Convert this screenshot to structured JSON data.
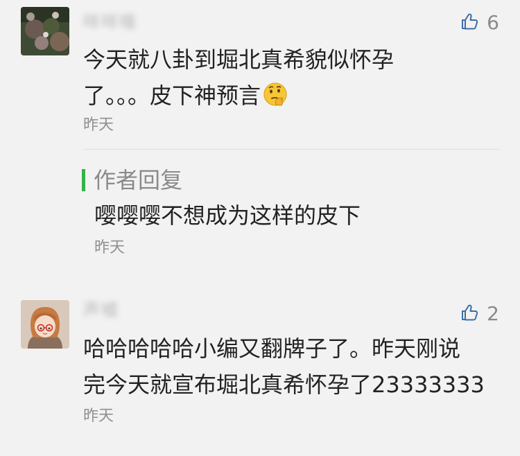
{
  "comments": [
    {
      "username": "咩咩嘻",
      "likes": "6",
      "content_line1": "今天就八卦到堀北真希貌似怀孕",
      "content_line2": "了。。。皮下神预言",
      "emoji": "thinking-face-icon",
      "time": "昨天",
      "reply": {
        "label": "作者回复",
        "content": "嘤嘤嘤不想成为这样的皮下",
        "time": "昨天"
      }
    },
    {
      "username": "声嘘",
      "likes": "2",
      "content_line1": "哈哈哈哈哈小编又翻牌子了。昨天刚说",
      "content_line2": "完今天就宣布堀北真希怀孕了23333333",
      "time": "昨天"
    }
  ],
  "colors": {
    "background": "#f2f2f2",
    "reply_accent": "#33b34a",
    "meta_text": "#8f8f8f"
  }
}
